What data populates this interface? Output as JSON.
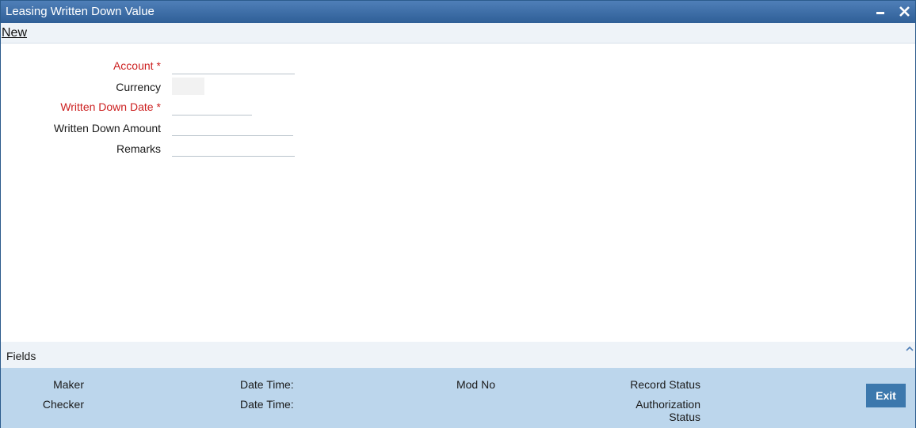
{
  "window": {
    "title": "Leasing Written Down Value"
  },
  "toolbar": {
    "new_label": "New"
  },
  "form": {
    "account": {
      "label": "Account",
      "required_mark": "*",
      "value": ""
    },
    "currency": {
      "label": "Currency",
      "value": ""
    },
    "written_down_date": {
      "label": "Written Down Date",
      "required_mark": "*",
      "value": ""
    },
    "written_down_amount": {
      "label": "Written Down Amount",
      "value": ""
    },
    "remarks": {
      "label": "Remarks",
      "value": ""
    }
  },
  "fields_section": {
    "label": "Fields"
  },
  "audit": {
    "maker_label": "Maker",
    "checker_label": "Checker",
    "maker_datetime_label": "Date Time:",
    "checker_datetime_label": "Date Time:",
    "mod_no_label": "Mod No",
    "record_status_label": "Record Status",
    "authorization_label_line1": "Authorization",
    "authorization_label_line2": "Status",
    "exit_label": "Exit"
  },
  "colors": {
    "titlebar": "#2f5f97",
    "required_label": "#cc1f1f",
    "audit_panel": "#bcd6ec",
    "exit_button": "#3c78ad"
  },
  "icons": {
    "minimize": "minimize-icon",
    "close": "close-icon",
    "collapse": "chevron-up-icon"
  }
}
